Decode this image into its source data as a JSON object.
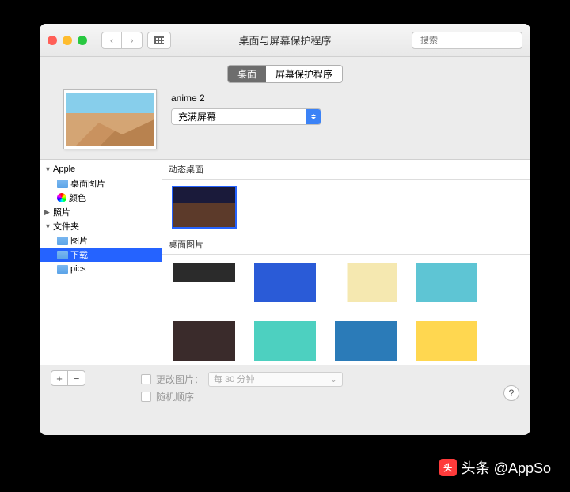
{
  "window": {
    "title": "桌面与屏幕保护程序"
  },
  "search": {
    "placeholder": "搜索"
  },
  "tabs": {
    "desktop": "桌面",
    "screensaver": "屏幕保护程序"
  },
  "preview": {
    "name": "anime 2",
    "fill_mode": "充满屏幕"
  },
  "sidebar": {
    "apple": "Apple",
    "desktop_pictures": "桌面图片",
    "colors": "颜色",
    "photos": "照片",
    "folders": "文件夹",
    "pictures": "图片",
    "downloads": "下载",
    "pics": "pics"
  },
  "sections": {
    "dynamic": "动态桌面",
    "desktop_pics": "桌面图片"
  },
  "footer": {
    "change_picture": "更改图片：",
    "interval": "每 30 分钟",
    "random": "随机顺序"
  },
  "watermark": {
    "text": "头条 @AppSo"
  }
}
